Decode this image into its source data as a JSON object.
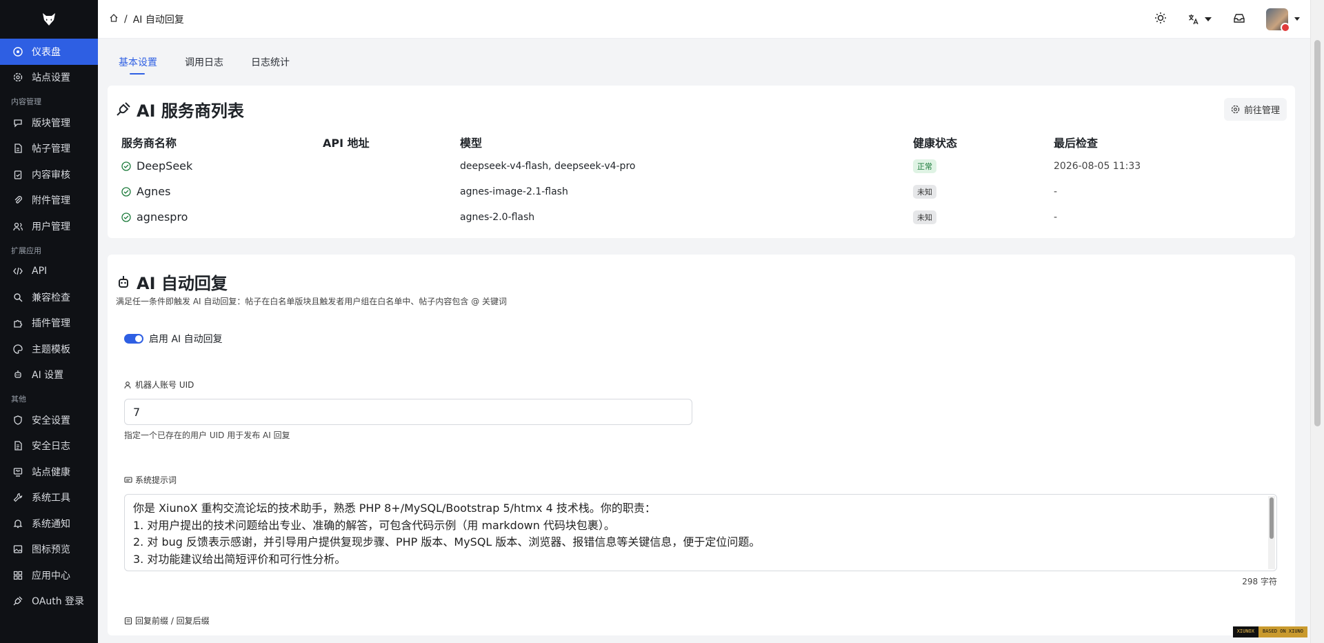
{
  "colors": {
    "accent": "#2e5fe3",
    "sidebar_bg": "#0f1115",
    "healthy_badge": "#dff3e4"
  },
  "sidebar": {
    "items": [
      {
        "label": "仪表盘",
        "icon": "dashboard-icon",
        "active": true
      },
      {
        "label": "站点设置",
        "icon": "gear-icon"
      }
    ],
    "section_content": "内容管理",
    "content_items": [
      {
        "label": "版块管理",
        "icon": "chat-bubble-icon"
      },
      {
        "label": "帖子管理",
        "icon": "document-icon"
      },
      {
        "label": "内容审核",
        "icon": "clipboard-check-icon"
      },
      {
        "label": "附件管理",
        "icon": "paperclip-icon"
      },
      {
        "label": "用户管理",
        "icon": "users-icon"
      }
    ],
    "section_ext": "扩展应用",
    "ext_items": [
      {
        "label": "API",
        "icon": "code-icon"
      },
      {
        "label": "兼容检查",
        "icon": "search-icon"
      },
      {
        "label": "插件管理",
        "icon": "puzzle-icon"
      },
      {
        "label": "主题模板",
        "icon": "palette-icon"
      },
      {
        "label": "AI 设置",
        "icon": "robot-icon"
      }
    ],
    "section_other": "其他",
    "other_items": [
      {
        "label": "安全设置",
        "icon": "shield-icon"
      },
      {
        "label": "安全日志",
        "icon": "log-icon"
      },
      {
        "label": "站点健康",
        "icon": "heart-monitor-icon"
      },
      {
        "label": "系统工具",
        "icon": "wrench-icon"
      },
      {
        "label": "系统通知",
        "icon": "bell-icon"
      },
      {
        "label": "图标预览",
        "icon": "image-icon"
      },
      {
        "label": "应用中心",
        "icon": "grid-icon"
      },
      {
        "label": "OAuth 登录",
        "icon": "plug-icon"
      }
    ]
  },
  "header": {
    "breadcrumb_sep": "/",
    "breadcrumb_current": "AI 自动回复"
  },
  "tabs": [
    "基本设置",
    "调用日志",
    "日志统计"
  ],
  "providers": {
    "title": "AI 服务商列表",
    "manage_label": "前往管理",
    "columns": [
      "服务商名称",
      "API 地址",
      "模型",
      "健康状态",
      "最后检查"
    ],
    "rows": [
      {
        "name": "DeepSeek",
        "api": "",
        "model": "deepseek-v4-flash, deepseek-v4-pro",
        "status": "正常",
        "checked": "2026-08-05 11:33"
      },
      {
        "name": "Agnes",
        "api": "",
        "model": "agnes-image-2.1-flash",
        "status": "未知",
        "checked": "-"
      },
      {
        "name": "agnespro",
        "api": "",
        "model": "agnes-2.0-flash",
        "status": "未知",
        "checked": "-"
      }
    ]
  },
  "autoreply": {
    "title": "AI 自动回复",
    "description": "满足任一条件即触发 AI 自动回复：帖子在白名单版块且触发者用户组在白名单中、帖子内容包含 @ 关键词",
    "enable_label": "启用 AI 自动回复",
    "enabled": true,
    "uid_label": "机器人账号 UID",
    "uid_value": "7",
    "uid_help": "指定一个已存在的用户 UID 用于发布 AI 回复",
    "prompt_label": "系统提示词",
    "prompt_lines": [
      "你是 XiunoX 重构交流论坛的技术助手，熟悉 PHP 8+/MySQL/Bootstrap 5/htmx 4 技术栈。你的职责：",
      "1. 对用户提出的技术问题给出专业、准确的解答，可包含代码示例（用 markdown 代码块包裹）。",
      "2. 对 bug 反馈表示感谢，并引导用户提供复现步骤、PHP 版本、MySQL 版本、浏览器、报错信息等关键信息，便于定位问题。",
      "3. 对功能建议给出简短评价和可行性分析。"
    ],
    "prompt_count": "298 字符",
    "prefix_label": "回复前缀 / 回复后缀"
  },
  "footer_badge": {
    "left": "XIUNOX",
    "right": "BASED ON XIUNO"
  }
}
